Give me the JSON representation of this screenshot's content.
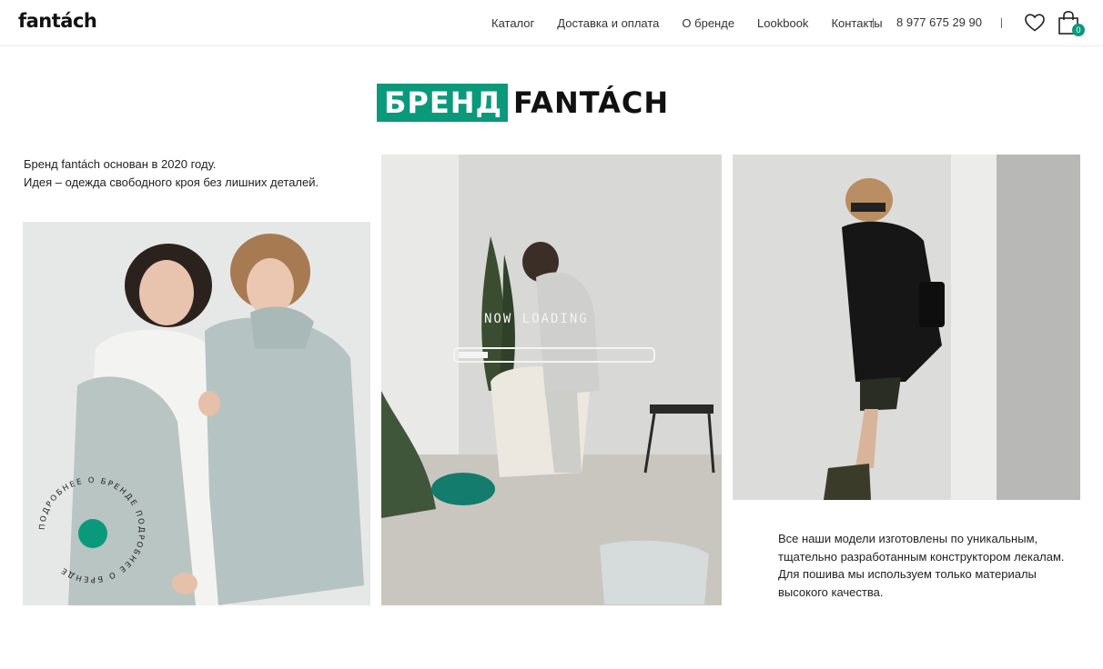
{
  "brand": {
    "logo": "fantách"
  },
  "nav": {
    "items": [
      "Каталог",
      "Доставка и оплата",
      "О бренде",
      "Lookbook",
      "Контакты"
    ],
    "phone": "8 977 675 29 90",
    "cart_count": "0"
  },
  "hero": {
    "title_highlight": "БРЕНД",
    "title_rest": "FANTÁCH"
  },
  "intro": {
    "line1": "Бренд fantách основан в 2020 году.",
    "line2": "Идея – одежда свободного кроя без лишних деталей."
  },
  "badge": {
    "text": "ПОДРОБНЕЕ О БРЕНДЕ ПОДРОБНЕЕ О БРЕНДЕ "
  },
  "video_overlay": {
    "text": "NOW LOADING"
  },
  "quality": {
    "line1": "Все наши модели изготовлены по уникальным,",
    "line2": "тщательно разработанным конструктором лекалам.",
    "line3": "Для пошива мы используем только материалы",
    "line4": "высокого качества."
  },
  "colors": {
    "accent": "#0a9a7b",
    "text": "#1a1a1a"
  },
  "icons": {
    "favorites": "heart-icon",
    "cart": "shopping-bag-icon"
  }
}
